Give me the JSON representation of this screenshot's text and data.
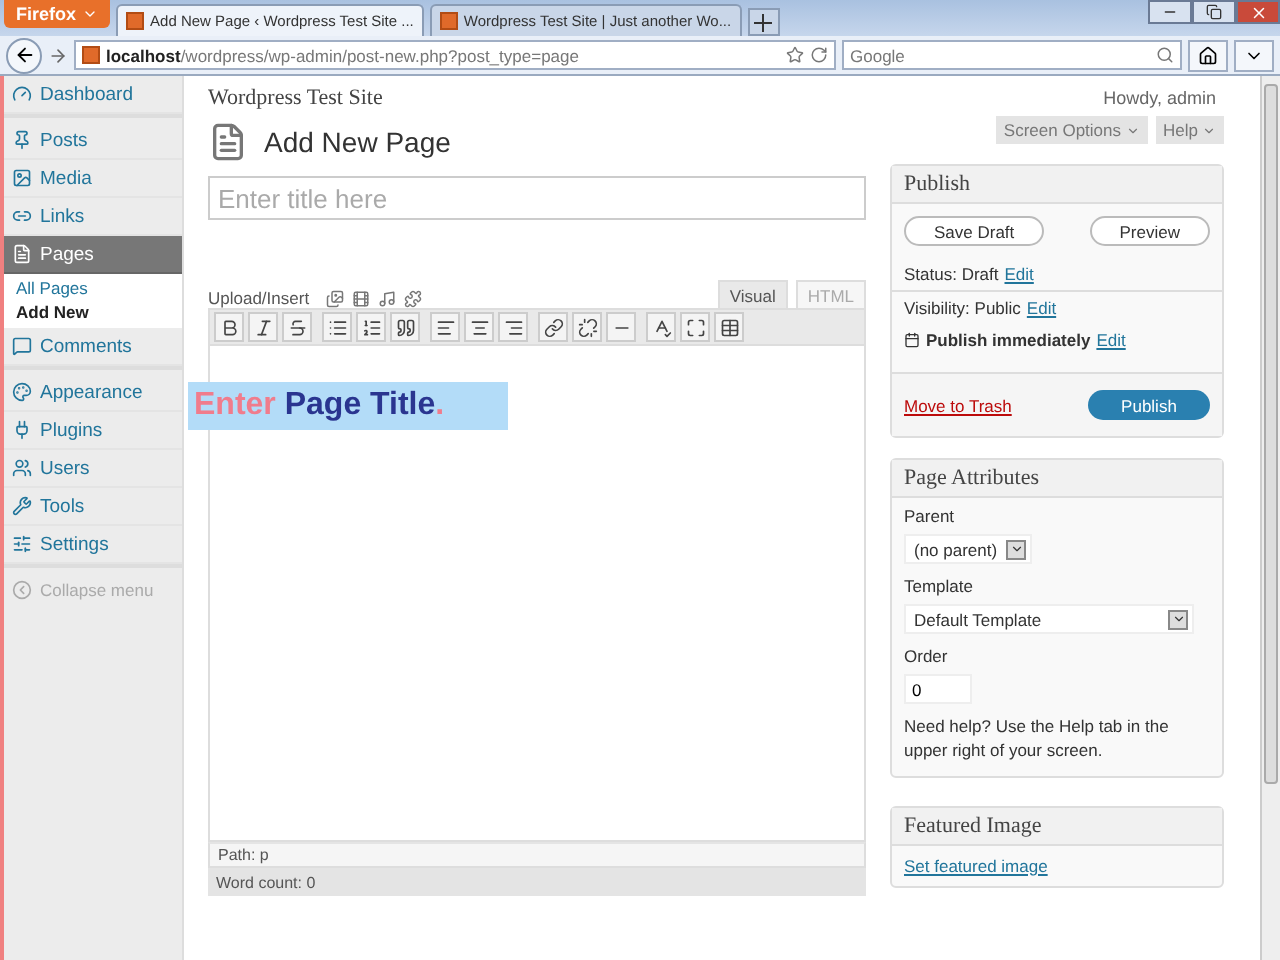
{
  "browser": {
    "menu_button": "Firefox",
    "tabs": [
      {
        "title": "Add New Page ‹ Wordpress Test Site ...",
        "selected": true
      },
      {
        "title": "Wordpress Test Site | Just another Wo...",
        "selected": false
      }
    ],
    "url": {
      "host": "localhost",
      "path": "/wordpress/wp-admin/post-new.php?post_type=page"
    },
    "search": {
      "placeholder": "Google"
    }
  },
  "sidebar": {
    "groups": [
      [
        {
          "label": "Dashboard",
          "selected": false
        }
      ],
      [
        {
          "label": "Posts",
          "selected": false
        },
        {
          "label": "Media",
          "selected": false
        },
        {
          "label": "Links",
          "selected": false
        },
        {
          "label": "Pages",
          "selected": true,
          "children": [
            {
              "label": "All Pages",
              "selected": false
            },
            {
              "label": "Add New",
              "selected": true
            }
          ]
        },
        {
          "label": "Comments",
          "selected": false
        }
      ],
      [
        {
          "label": "Appearance",
          "selected": false
        },
        {
          "label": "Plugins",
          "selected": false
        },
        {
          "label": "Users",
          "selected": false
        },
        {
          "label": "Tools",
          "selected": false
        },
        {
          "label": "Settings",
          "selected": false
        }
      ]
    ],
    "collapse": "Collapse menu"
  },
  "header": {
    "site_title": "Wordpress Test Site",
    "user": "Howdy, admin",
    "buttons": [
      "Screen Options",
      "Help"
    ]
  },
  "editor": {
    "heading": "Add New Page",
    "title_placeholder": "Enter title here",
    "upload_label": "Upload/Insert",
    "tabs": [
      {
        "label": "Visual",
        "selected": true
      },
      {
        "label": "HTML",
        "selected": false
      }
    ],
    "path": "Path: p",
    "word_count": "Word count: 0"
  },
  "callout": {
    "parts": [
      {
        "text": "Enter ",
        "color": "#f07c8c"
      },
      {
        "text": "Page Title",
        "color": "#2a3590"
      },
      {
        "text": ".",
        "color": "#f07c8c"
      }
    ]
  },
  "publish": {
    "title": "Publish",
    "save_draft": "Save Draft",
    "preview": "Preview",
    "rows": [
      {
        "label": "Status: Draft",
        "link": "Edit"
      },
      {
        "label": "Visibility: Public",
        "link": "Edit"
      },
      {
        "label": "Publish immediately",
        "link": "Edit"
      }
    ],
    "trash": "Move to Trash",
    "publish": "Publish"
  },
  "page_attributes": {
    "title": "Page Attributes",
    "parent_label": "Parent",
    "parent_value": "(no parent)",
    "template_label": "Template",
    "template_value": "Default Template",
    "order_label": "Order",
    "order_value": "0",
    "help": "Need help? Use the Help tab in the upper right of your screen."
  },
  "featured_image": {
    "title": "Featured Image",
    "link": "Set featured image"
  }
}
